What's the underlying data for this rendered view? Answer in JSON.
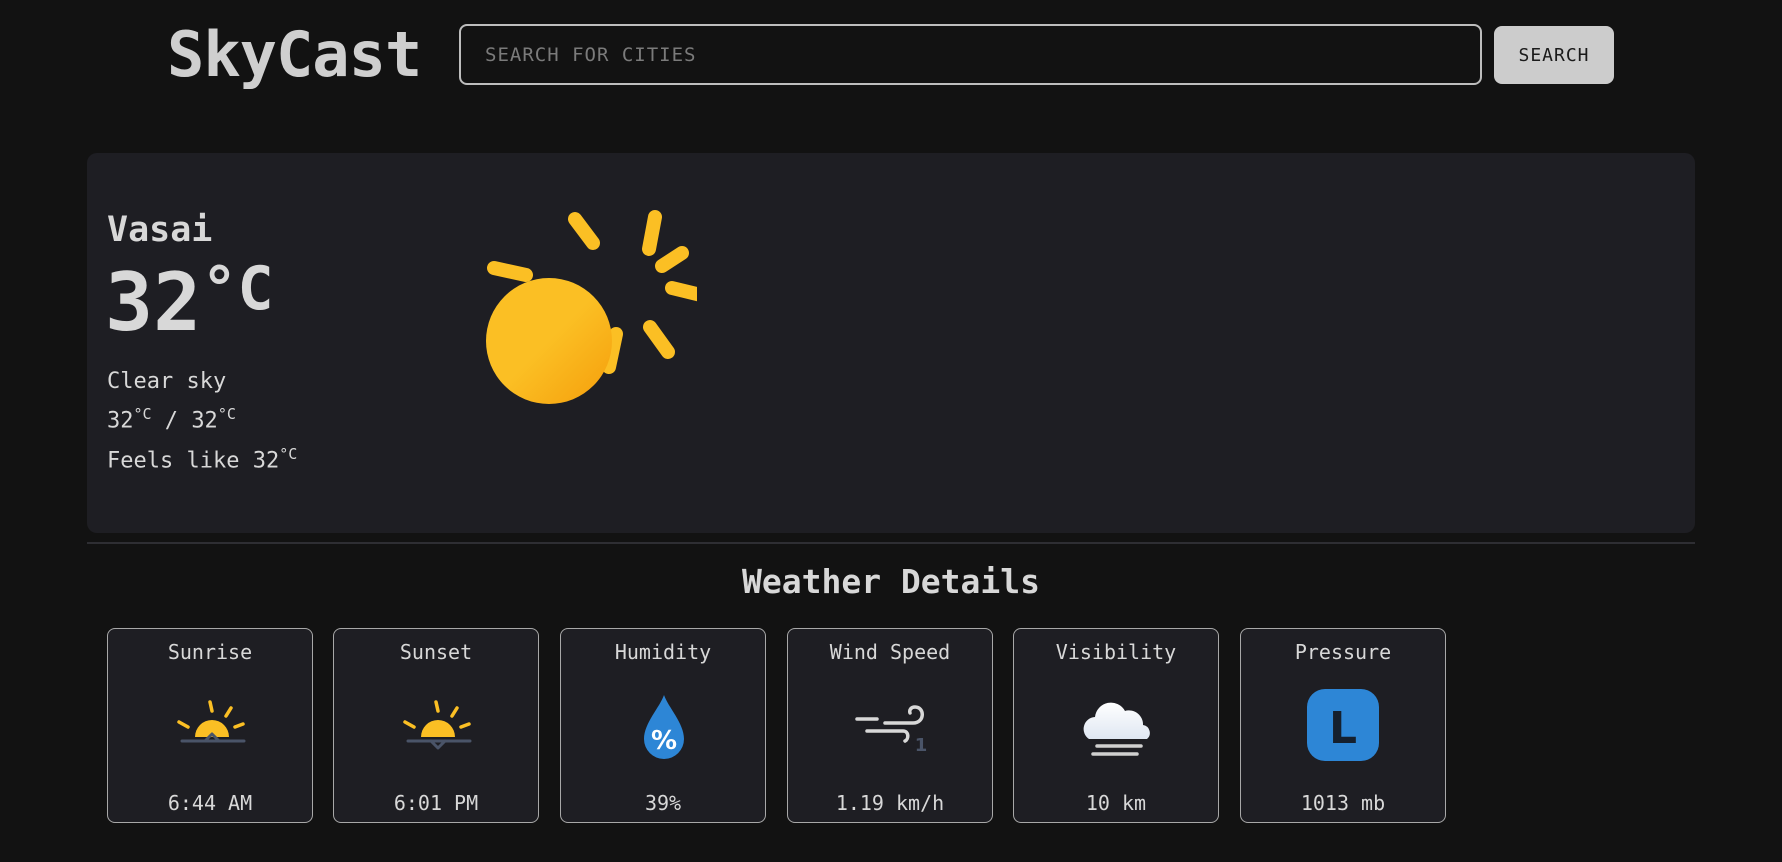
{
  "app": {
    "title": "SkyCast"
  },
  "search": {
    "placeholder": "SEARCH FOR CITIES",
    "value": "",
    "button_label": "SEARCH"
  },
  "current": {
    "city": "Vasai",
    "temp_value": "32",
    "temp_unit": "°C",
    "condition": "Clear sky",
    "min_temp": "32",
    "max_temp": "32",
    "range_separator": " / ",
    "feels_prefix": "Feels like ",
    "feels_value": "32",
    "unit_small": "°C",
    "weather_icon": "clear-day-sun-icon"
  },
  "details": {
    "title": "Weather Details",
    "items": [
      {
        "label": "Sunrise",
        "value": "6:44 AM",
        "icon": "sunrise-icon"
      },
      {
        "label": "Sunset",
        "value": "6:01 PM",
        "icon": "sunset-icon"
      },
      {
        "label": "Humidity",
        "value": "39%",
        "icon": "humidity-drop-icon"
      },
      {
        "label": "Wind Speed",
        "value": "1.19 km/h",
        "icon": "wind-icon"
      },
      {
        "label": "Visibility",
        "value": "10 km",
        "icon": "fog-cloud-icon"
      },
      {
        "label": "Pressure",
        "value": "1013 mb",
        "icon": "pressure-low-icon",
        "badge_letter": "L"
      }
    ]
  },
  "colors": {
    "background": "#121212",
    "card": "#1e1e23",
    "sun": "#fbbf24",
    "sun_dark": "#f59e0b",
    "humidity": "#2d86d6",
    "pressure": "#2d86d6"
  }
}
